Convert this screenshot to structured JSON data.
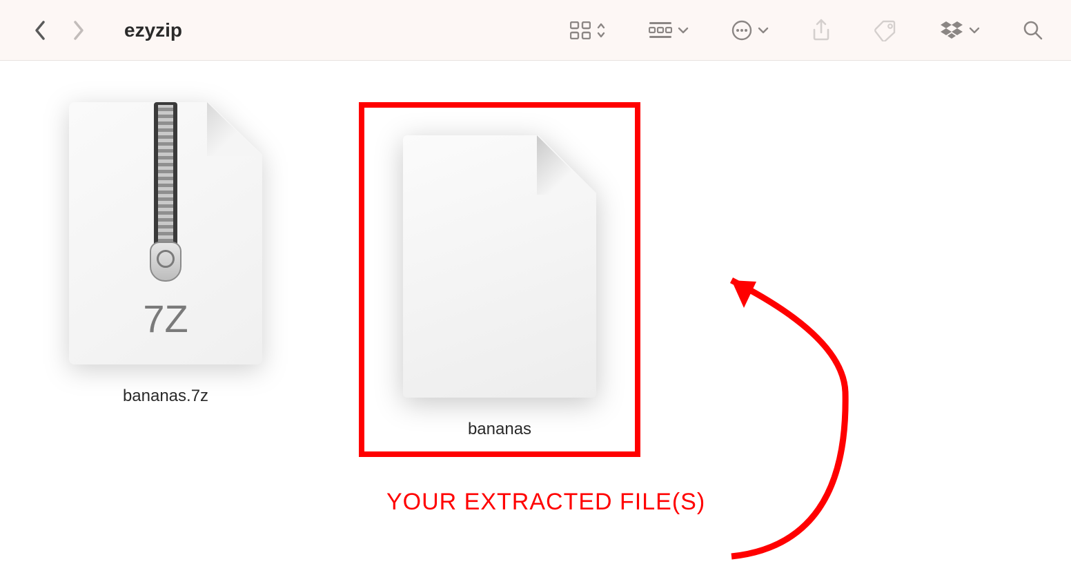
{
  "toolbar": {
    "title": "ezyzip"
  },
  "files": [
    {
      "name": "bananas.7z",
      "type_label": "7Z"
    },
    {
      "name": "bananas"
    }
  ],
  "annotation": {
    "text": "YOUR EXTRACTED FILE(S)"
  },
  "colors": {
    "highlight": "#ff0000"
  }
}
